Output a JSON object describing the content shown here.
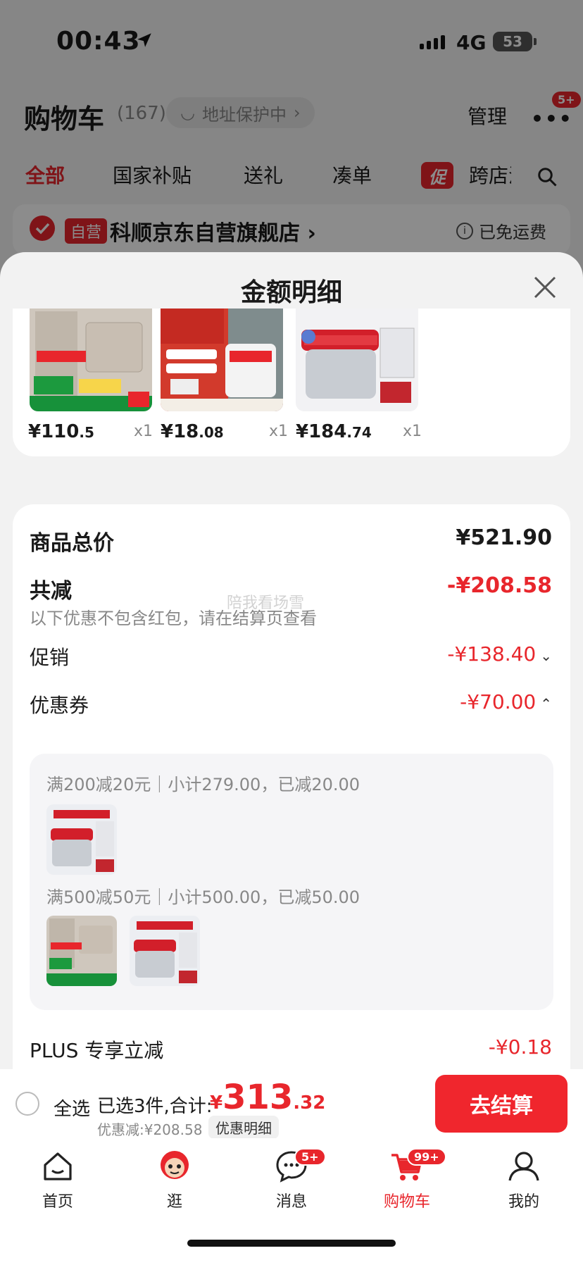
{
  "status_bar": {
    "time": "00:43",
    "network": "4G",
    "battery": "53"
  },
  "header": {
    "title": "购物车",
    "count": "(167)",
    "address_status": "地址保护中",
    "manage": "管理",
    "more_badge": "5+"
  },
  "tabs": [
    "全部",
    "国家补贴",
    "送礼",
    "凑单",
    "跨店满"
  ],
  "promo_icon": "促",
  "store": {
    "tag": "自营",
    "name": "科顺京东自营旗舰店",
    "shipping": "已免运费"
  },
  "sheet": {
    "title": "金额明细",
    "products": [
      {
        "price_int": "¥110",
        "price_dec": ".5",
        "qty": "x1"
      },
      {
        "price_int": "¥18",
        "price_dec": ".08",
        "qty": "x1"
      },
      {
        "price_int": "¥184",
        "price_dec": ".74",
        "qty": "x1"
      }
    ],
    "product_total": {
      "label": "商品总价",
      "value": "¥521.90"
    },
    "total_discount": {
      "label": "共减",
      "value": "-¥208.58",
      "note": "以下优惠不包含红包，请在结算页查看"
    },
    "promotion": {
      "label": "促销",
      "value": "-¥138.40"
    },
    "coupon": {
      "label": "优惠券",
      "value": "-¥70.00"
    },
    "coupon_groups": [
      {
        "text": "满200减20元｜小计279.00，已减20.00"
      },
      {
        "text": "满500减50元｜小计500.00，已减50.00"
      }
    ],
    "plus": {
      "label": "PLUS 专享立减",
      "value": "-¥0.18"
    },
    "watermark": "陪我看场雪"
  },
  "checkout": {
    "select_all": "全选",
    "selected": "已选3件,合计:",
    "yen": "¥",
    "total_int": "313",
    "total_dec": ".32",
    "saved": "优惠减:¥208.58",
    "detail": "优惠明细",
    "button": "去结算"
  },
  "tabbar": {
    "items": [
      {
        "label": "首页"
      },
      {
        "label": "逛"
      },
      {
        "label": "消息",
        "badge": "5+"
      },
      {
        "label": "购物车",
        "badge": "99+"
      },
      {
        "label": "我的"
      }
    ]
  },
  "colors": {
    "accent": "#e8262c",
    "background": "#f2f2f2"
  }
}
